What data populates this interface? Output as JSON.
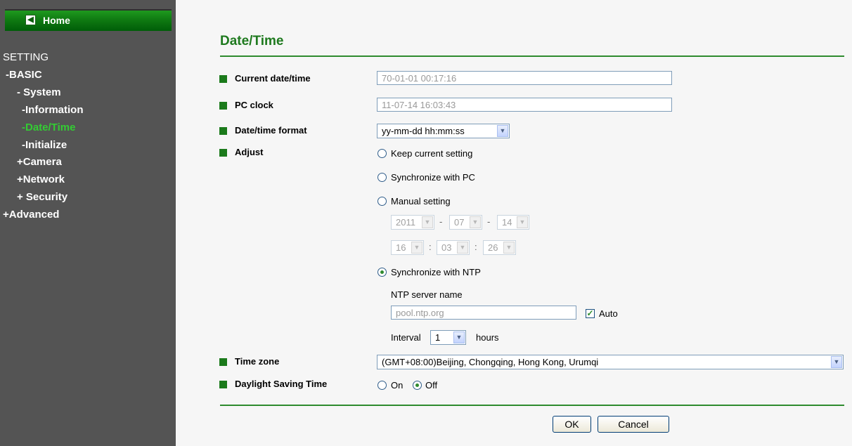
{
  "sidebar": {
    "home_label": "Home",
    "setting_label": "SETTING",
    "items": [
      {
        "label": "-BASIC"
      },
      {
        "label": "- System"
      },
      {
        "label": "-Information"
      },
      {
        "label": "-Date/Time"
      },
      {
        "label": "-Initialize"
      },
      {
        "label": "+Camera"
      },
      {
        "label": "+Network"
      },
      {
        "label": "+ Security"
      },
      {
        "label": "+Advanced"
      }
    ],
    "active_color": "#33cc33"
  },
  "page": {
    "title": "Date/Time",
    "accent_color": "#1f7a1f"
  },
  "fields": {
    "current_datetime": {
      "label": "Current date/time",
      "value": "70-01-01   00:17:16"
    },
    "pc_clock": {
      "label": "PC clock",
      "value": "11-07-14   16:03:43"
    },
    "datetime_format": {
      "label": "Date/time format",
      "value": "yy-mm-dd hh:mm:ss"
    },
    "adjust": {
      "label": "Adjust",
      "options": {
        "keep": "Keep current setting",
        "sync_pc": "Synchronize with PC",
        "manual": "Manual setting",
        "ntp": "Synchronize with NTP"
      },
      "selected": "Synchronize with NTP",
      "manual": {
        "year": "2011",
        "month": "07",
        "day": "14",
        "hour": "16",
        "minute": "03",
        "second": "26",
        "date_sep": "-",
        "time_sep": ":"
      },
      "ntp": {
        "server_label": "NTP server name",
        "server_value": "pool.ntp.org",
        "auto_label": "Auto",
        "auto_checked": true,
        "interval_label": "Interval",
        "interval_value": "1",
        "interval_unit": "hours"
      }
    },
    "time_zone": {
      "label": "Time zone",
      "value": "(GMT+08:00)Beijing, Chongqing, Hong Kong, Urumqi"
    },
    "dst": {
      "label": "Daylight Saving Time",
      "on_label": "On",
      "off_label": "Off",
      "selected": "Off"
    }
  },
  "buttons": {
    "ok": "OK",
    "cancel": "Cancel"
  }
}
